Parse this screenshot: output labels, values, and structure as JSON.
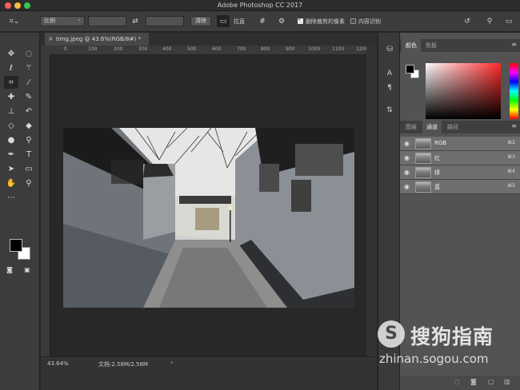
{
  "window": {
    "title": "Adobe Photoshop CC 2017"
  },
  "options_bar": {
    "ratio_select": "比例",
    "clear_button": "清除",
    "straighten_label": "拉直",
    "delete_cropped_label": "删除裁剪的像素",
    "delete_cropped_checked": true,
    "content_aware_label": "内容识别",
    "content_aware_checked": false
  },
  "document": {
    "tab_title": "timg.jpeg @ 43.6%(RGB/8#) *",
    "ruler_ticks": [
      "0",
      "100",
      "200",
      "300",
      "400",
      "500",
      "600",
      "700",
      "800",
      "900",
      "1000",
      "1100",
      "1200"
    ]
  },
  "status": {
    "zoom": "43.64%",
    "doc_info": "文档:2.58M/2.58M"
  },
  "panels": {
    "color_tabs": [
      "颜色",
      "色板"
    ],
    "layers_tabs": [
      "图层",
      "通道",
      "路径"
    ],
    "channels": [
      {
        "name": "RGB",
        "shortcut": "⌘2"
      },
      {
        "name": "红",
        "shortcut": "⌘3"
      },
      {
        "name": "绿",
        "shortcut": "⌘4"
      },
      {
        "name": "蓝",
        "shortcut": "⌘5"
      }
    ]
  },
  "watermark": {
    "logo": "S",
    "brand": "搜狗指南",
    "url": "zhinan.sogou.com"
  },
  "colors": {
    "foreground": "#000000",
    "background": "#ffffff",
    "accent": "#ff2a2a"
  },
  "icons": {
    "tools": [
      "move-tool",
      "marquee-tool",
      "lasso-tool",
      "magic-wand-tool",
      "crop-tool",
      "eyedropper-tool",
      "healing-brush-tool",
      "brush-tool",
      "clone-stamp-tool",
      "history-brush-tool",
      "eraser-tool",
      "paint-bucket-tool",
      "blur-tool",
      "dodge-tool",
      "pen-tool",
      "type-tool",
      "path-selection-tool",
      "rectangle-tool",
      "hand-tool",
      "zoom-tool"
    ]
  }
}
